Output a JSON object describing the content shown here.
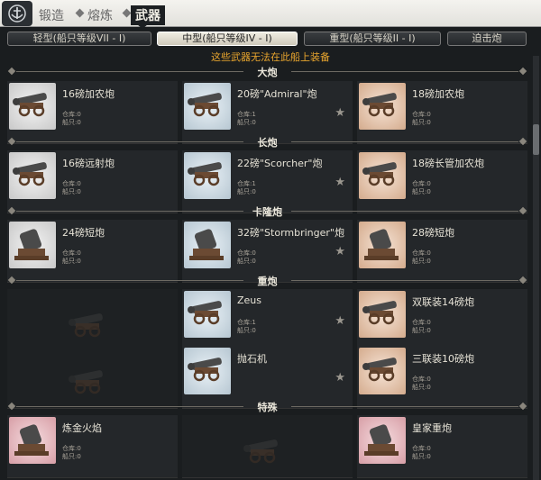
{
  "nav": {
    "tabs": [
      {
        "label": "锻造"
      },
      {
        "label": "熔炼"
      },
      {
        "label": "武器"
      }
    ]
  },
  "subtabs": [
    {
      "label": "轻型(船只等级VII - I)"
    },
    {
      "label": "中型(船只等级IV - I)"
    },
    {
      "label": "重型(船只等级II - I)"
    },
    {
      "label": "迫击炮"
    }
  ],
  "warning": "这些武器无法在此船上装备",
  "sections": [
    {
      "title": "大炮"
    },
    {
      "title": "长炮"
    },
    {
      "title": "卡隆炮"
    },
    {
      "title": "重炮"
    },
    {
      "title": "特殊"
    }
  ],
  "stat_labels": {
    "storage": "仓库:",
    "ship": "船只:"
  },
  "cards": [
    {
      "name": "16磅加农炮",
      "storage": "0",
      "ship": "0"
    },
    {
      "name": "20磅\"Admiral\"炮",
      "storage": "1",
      "ship": "0"
    },
    {
      "name": "18磅加农炮",
      "storage": "0",
      "ship": "0"
    },
    {
      "name": "16磅远射炮",
      "storage": "0",
      "ship": "0"
    },
    {
      "name": "22磅\"Scorcher\"炮",
      "storage": "1",
      "ship": "0"
    },
    {
      "name": "18磅长管加农炮",
      "storage": "0",
      "ship": "0"
    },
    {
      "name": "24磅短炮",
      "storage": "0",
      "ship": "0"
    },
    {
      "name": "32磅\"Stormbringer\"炮",
      "storage": "0",
      "ship": "0"
    },
    {
      "name": "28磅短炮",
      "storage": "0",
      "ship": "0"
    },
    {
      "name": "Zeus",
      "storage": "1",
      "ship": "0"
    },
    {
      "name": "双联装14磅炮",
      "storage": "0",
      "ship": "0"
    },
    {
      "name": "抛石机",
      "storage": "0",
      "ship": "0"
    },
    {
      "name": "三联装10磅炮",
      "storage": "0",
      "ship": "0"
    },
    {
      "name": "炼金火焰",
      "storage": "0",
      "ship": "0"
    },
    {
      "name": "皇家重炮",
      "storage": "0",
      "ship": "0"
    }
  ],
  "icons": {
    "star": "★"
  },
  "colors": {
    "warning": "#e8a52e",
    "background": "#1a1d1f",
    "card": "#24272a"
  }
}
